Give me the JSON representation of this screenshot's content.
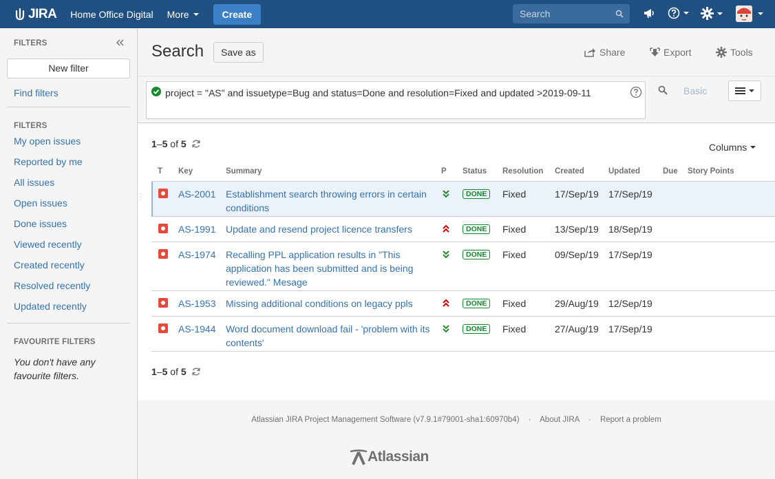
{
  "topnav": {
    "logo_text": "JIRA",
    "project": "Home Office Digital",
    "more": "More",
    "create": "Create",
    "search_placeholder": "Search"
  },
  "sidebar": {
    "filters_heading": "FILTERS",
    "new_filter": "New filter",
    "find_filters": "Find filters",
    "filters_heading2": "FILTERS",
    "items": [
      {
        "label": "My open issues"
      },
      {
        "label": "Reported by me"
      },
      {
        "label": "All issues"
      },
      {
        "label": "Open issues"
      },
      {
        "label": "Done issues"
      },
      {
        "label": "Viewed recently"
      },
      {
        "label": "Created recently"
      },
      {
        "label": "Resolved recently"
      },
      {
        "label": "Updated recently"
      }
    ],
    "favourite_heading": "FAVOURITE FILTERS",
    "favourite_empty": "You don't have any favourite filters."
  },
  "header": {
    "title": "Search",
    "save_as": "Save as",
    "share": "Share",
    "export": "Export",
    "tools": "Tools"
  },
  "query": {
    "jql": "project = \"AS\" and issuetype=Bug and status=Done and resolution=Fixed and updated >2019-09-11",
    "basic": "Basic"
  },
  "pager": {
    "range_start": "1",
    "range_sep": "–",
    "range_end": "5",
    "of": "of",
    "total": "5"
  },
  "columns_label": "Columns",
  "table": {
    "headers": {
      "type": "T",
      "key": "Key",
      "summary": "Summary",
      "priority": "P",
      "status": "Status",
      "resolution": "Resolution",
      "created": "Created",
      "updated": "Updated",
      "due": "Due",
      "story_points": "Story Points"
    },
    "rows": [
      {
        "key": "AS-2001",
        "summary": "Establishment search throwing errors in certain conditions",
        "priority": "lowest",
        "status": "DONE",
        "resolution": "Fixed",
        "created": "17/Sep/19",
        "updated": "17/Sep/19"
      },
      {
        "key": "AS-1991",
        "summary": "Update and resend project licence transfers",
        "priority": "highest",
        "status": "DONE",
        "resolution": "Fixed",
        "created": "13/Sep/19",
        "updated": "18/Sep/19"
      },
      {
        "key": "AS-1974",
        "summary": "Recalling PPL application results in \"This application has been submitted and is being reviewed.\" Mesage",
        "priority": "lowest",
        "status": "DONE",
        "resolution": "Fixed",
        "created": "09/Sep/19",
        "updated": "17/Sep/19"
      },
      {
        "key": "AS-1953",
        "summary": "Missing additional conditions on legacy ppls",
        "priority": "highest",
        "status": "DONE",
        "resolution": "Fixed",
        "created": "29/Aug/19",
        "updated": "12/Sep/19"
      },
      {
        "key": "AS-1944",
        "summary": "Word document download fail - 'problem with its contents'",
        "priority": "lowest",
        "status": "DONE",
        "resolution": "Fixed",
        "created": "27/Aug/19",
        "updated": "17/Sep/19"
      }
    ]
  },
  "footer": {
    "software": "Atlassian JIRA Project Management Software (v7.9.1#79001-sha1:60970b4)",
    "about": "About JIRA",
    "report": "Report a problem",
    "brand": "Atlassian"
  },
  "colors": {
    "nav": "#205081",
    "link": "#3572b0",
    "done": "#14892c",
    "bug": "#e5493a",
    "priority_low": "#2a8735",
    "priority_high": "#ce0000"
  }
}
